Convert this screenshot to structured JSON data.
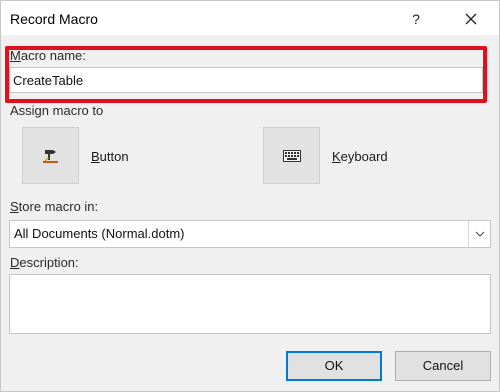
{
  "dialog": {
    "title": "Record Macro",
    "help_label": "?",
    "close_icon": "close-icon"
  },
  "macro_name": {
    "label_first": "M",
    "label_rest": "acro name:",
    "value": "CreateTable",
    "highlight_color": "#e0101e"
  },
  "assign": {
    "label": "Assign macro to",
    "button": {
      "label_first": "B",
      "label_rest": "utton",
      "icon": "hammer-icon"
    },
    "keyboard": {
      "label_first": "K",
      "label_rest": "eyboard",
      "icon": "keyboard-icon"
    }
  },
  "store": {
    "label_first": "S",
    "label_rest": "tore macro in:",
    "selected": "All Documents (Normal.dotm)"
  },
  "description": {
    "label_first": "D",
    "label_rest": "escription:",
    "value": ""
  },
  "footer": {
    "ok_label": "OK",
    "cancel_label": "Cancel",
    "accent": "#0078d7"
  }
}
